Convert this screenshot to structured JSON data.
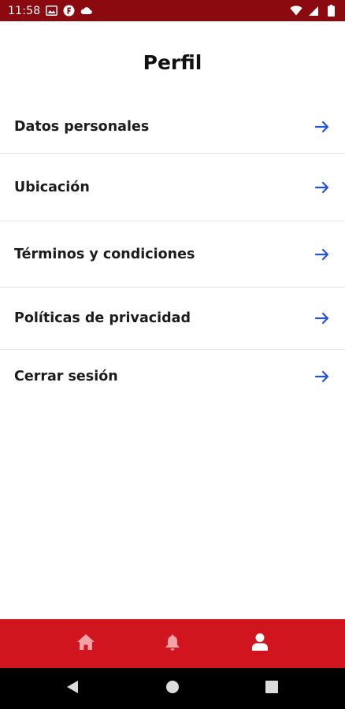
{
  "status_bar": {
    "time": "11:58",
    "icons_left": [
      "gallery-icon",
      "app-notification-icon",
      "cloud-icon"
    ],
    "icons_right": [
      "wifi-icon",
      "cellular-signal-icon",
      "battery-icon"
    ]
  },
  "header": {
    "title": "Perfil"
  },
  "menu": {
    "items": [
      {
        "label": "Datos personales",
        "icon": "arrow-right-icon"
      },
      {
        "label": "Ubicación",
        "icon": "arrow-right-icon"
      },
      {
        "label": "Términos y condiciones",
        "icon": "arrow-right-icon"
      },
      {
        "label": "Políticas de privacidad",
        "icon": "arrow-right-icon"
      },
      {
        "label": "Cerrar sesión",
        "icon": "arrow-right-icon"
      }
    ]
  },
  "bottom_nav": {
    "items": [
      {
        "icon": "home-icon",
        "active": false
      },
      {
        "icon": "bell-icon",
        "active": false
      },
      {
        "icon": "user-icon",
        "active": true
      }
    ]
  },
  "system_nav": {
    "buttons": [
      "back-icon",
      "home-circle-icon",
      "recents-icon"
    ]
  },
  "colors": {
    "status_bar_bg": "#8b0a0f",
    "bottom_nav_bg": "#d0151f",
    "nav_icon_inactive": "#f5a3a7",
    "nav_icon_active": "#ffffff",
    "arrow": "#2452e8",
    "divider": "#e3e3e3"
  }
}
